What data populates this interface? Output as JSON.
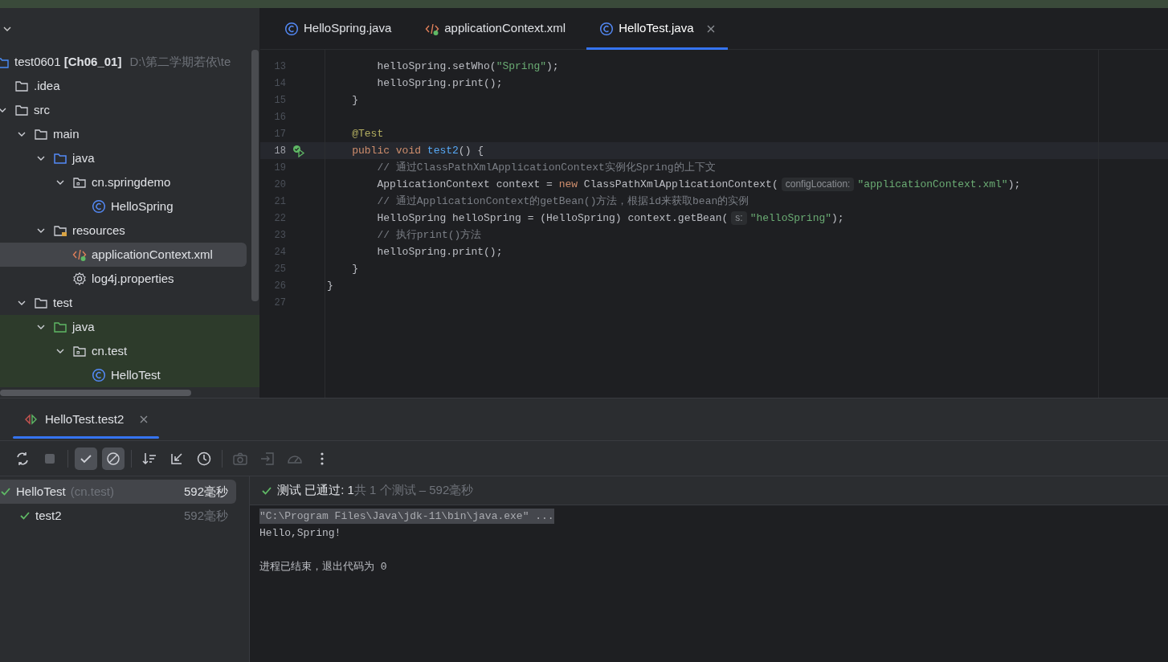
{
  "project_panel": {
    "tree": [
      {
        "kind": "project",
        "label": "test0601 **[Ch06_01]**",
        "path": "D:\\第二学期若依\\te",
        "selected": false,
        "tinted": false,
        "children": [
          {
            "kind": "folder",
            "label": ".idea",
            "selected": false,
            "tinted": false
          },
          {
            "kind": "folder",
            "label": "src",
            "expanded": true,
            "selected": false,
            "tinted": false,
            "children": [
              {
                "kind": "folder",
                "label": "main",
                "expanded": true,
                "selected": false,
                "tinted": false,
                "children": [
                  {
                    "kind": "source-folder",
                    "label": "java",
                    "expanded": true,
                    "selected": false,
                    "tinted": false,
                    "children": [
                      {
                        "kind": "package",
                        "label": "cn.springdemo",
                        "expanded": true,
                        "selected": false,
                        "tinted": false,
                        "children": [
                          {
                            "kind": "class",
                            "label": "HelloSpring",
                            "selected": false,
                            "tinted": false
                          }
                        ]
                      }
                    ]
                  },
                  {
                    "kind": "resource-folder",
                    "label": "resources",
                    "expanded": true,
                    "selected": false,
                    "tinted": false,
                    "children": [
                      {
                        "kind": "xml",
                        "label": "applicationContext.xml",
                        "selected": true,
                        "tinted": false
                      },
                      {
                        "kind": "properties",
                        "label": "log4j.properties",
                        "selected": false,
                        "tinted": false
                      }
                    ]
                  }
                ]
              },
              {
                "kind": "folder",
                "label": "test",
                "expanded": true,
                "selected": false,
                "tinted": false,
                "children": [
                  {
                    "kind": "test-folder",
                    "label": "java",
                    "expanded": true,
                    "selected": false,
                    "tinted": true,
                    "children": [
                      {
                        "kind": "package",
                        "label": "cn.test",
                        "expanded": true,
                        "selected": false,
                        "tinted": true,
                        "children": [
                          {
                            "kind": "class",
                            "label": "HelloTest",
                            "selected": false,
                            "tinted": true
                          }
                        ]
                      }
                    ]
                  }
                ]
              }
            ]
          }
        ]
      }
    ]
  },
  "editor": {
    "tabs": [
      {
        "kind": "class",
        "label": "HelloSpring.java",
        "selected": false,
        "closable": false
      },
      {
        "kind": "xml",
        "label": "applicationContext.xml",
        "selected": false,
        "closable": false
      },
      {
        "kind": "class",
        "label": "HelloTest.java",
        "selected": true,
        "closable": true
      }
    ],
    "lines": [
      {
        "number": "13",
        "current": false,
        "run_marker": false,
        "tokens": [
          {
            "kind": "plain",
            "text": "        helloSpring.setWho("
          },
          {
            "kind": "string",
            "text": "\"Spring\""
          },
          {
            "kind": "plain",
            "text": ");"
          }
        ]
      },
      {
        "number": "14",
        "current": false,
        "run_marker": false,
        "tokens": [
          {
            "kind": "plain",
            "text": "        helloSpring.print();"
          }
        ]
      },
      {
        "number": "15",
        "current": false,
        "run_marker": false,
        "tokens": [
          {
            "kind": "plain",
            "text": "    }"
          }
        ]
      },
      {
        "number": "16",
        "current": false,
        "run_marker": false
      },
      {
        "number": "17",
        "current": false,
        "run_marker": false,
        "tokens": [
          {
            "kind": "annotation",
            "text": "    @Test"
          }
        ]
      },
      {
        "number": "18",
        "current": true,
        "run_marker": true,
        "tokens": [
          {
            "kind": "keyword",
            "text": "    public void "
          },
          {
            "kind": "method",
            "text": "test2"
          },
          {
            "kind": "plain",
            "text": "() {"
          }
        ]
      },
      {
        "number": "19",
        "current": false,
        "run_marker": false,
        "tokens": [
          {
            "kind": "comment",
            "text": "        // 通过ClassPathXmlApplicationContext实例化Spring的上下文"
          }
        ]
      },
      {
        "number": "20",
        "current": false,
        "run_marker": false,
        "tokens": [
          {
            "kind": "plain",
            "text": "        ApplicationContext context = "
          },
          {
            "kind": "keyword",
            "text": "new"
          },
          {
            "kind": "plain",
            "text": " ClassPathXmlApplicationContext("
          },
          {
            "kind": "hint",
            "text": "configLocation:"
          },
          {
            "kind": "string",
            "text": "\"applicationContext.xml\""
          },
          {
            "kind": "plain",
            "text": ");"
          }
        ]
      },
      {
        "number": "21",
        "current": false,
        "run_marker": false,
        "tokens": [
          {
            "kind": "comment",
            "text": "        // 通过ApplicationContext的getBean()方法，根据id来获取bean的实例"
          }
        ]
      },
      {
        "number": "22",
        "current": false,
        "run_marker": false,
        "tokens": [
          {
            "kind": "plain",
            "text": "        HelloSpring helloSpring = (HelloSpring) context.getBean("
          },
          {
            "kind": "hint",
            "text": "s:"
          },
          {
            "kind": "string",
            "text": "\"helloSpring\""
          },
          {
            "kind": "plain",
            "text": ");"
          }
        ]
      },
      {
        "number": "23",
        "current": false,
        "run_marker": false,
        "tokens": [
          {
            "kind": "comment",
            "text": "        // 执行print()方法"
          }
        ]
      },
      {
        "number": "24",
        "current": false,
        "run_marker": false,
        "tokens": [
          {
            "kind": "plain",
            "text": "        helloSpring.print();"
          }
        ]
      },
      {
        "number": "25",
        "current": false,
        "run_marker": false,
        "tokens": [
          {
            "kind": "plain",
            "text": "    }"
          }
        ]
      },
      {
        "number": "26",
        "current": false,
        "run_marker": false,
        "tokens": [
          {
            "kind": "plain",
            "text": "}"
          }
        ]
      },
      {
        "number": "27",
        "current": false,
        "run_marker": false
      }
    ]
  },
  "run_panel": {
    "tabs": [
      {
        "label": "HelloTest.test2",
        "selected": true,
        "closable": true
      }
    ],
    "toolbar": [
      {
        "kind": "rerun-failed",
        "on": false,
        "disabled": false
      },
      {
        "kind": "stop",
        "on": false,
        "disabled": true
      },
      {
        "kind": "show-passed",
        "on": true,
        "disabled": false
      },
      {
        "kind": "show-ignored",
        "on": true,
        "disabled": false
      },
      {
        "kind": "sort",
        "on": false,
        "disabled": false
      },
      {
        "kind": "collapse",
        "on": false,
        "disabled": false
      },
      {
        "kind": "history",
        "on": false,
        "disabled": false
      },
      {
        "kind": "camera",
        "on": false,
        "disabled": true
      },
      {
        "kind": "import",
        "on": false,
        "disabled": true
      },
      {
        "kind": "gauge",
        "on": false,
        "disabled": true
      },
      {
        "kind": "more",
        "on": false,
        "disabled": false
      }
    ],
    "tests": [
      {
        "label": "HelloTest",
        "package": "(cn.test)",
        "time": "592毫秒",
        "selected": true,
        "passed": true,
        "children": [
          {
            "label": "test2",
            "time": "592毫秒",
            "selected": false,
            "passed": true
          }
        ]
      }
    ],
    "status": {
      "passed": true,
      "text": "测试 已通过: 1",
      "detail": "共 1 个测试 – 592毫秒"
    },
    "console": [
      {
        "kind": "text",
        "text": "\"C:\\Program Files\\Java\\jdk-11\\bin\\java.exe\" ...",
        "highlighted": true
      },
      {
        "kind": "text",
        "text": "Hello,Spring!",
        "highlighted": false
      },
      {
        "kind": "blank"
      },
      {
        "kind": "text",
        "text": "进程已结束，退出代码为 0",
        "highlighted": false
      }
    ]
  }
}
